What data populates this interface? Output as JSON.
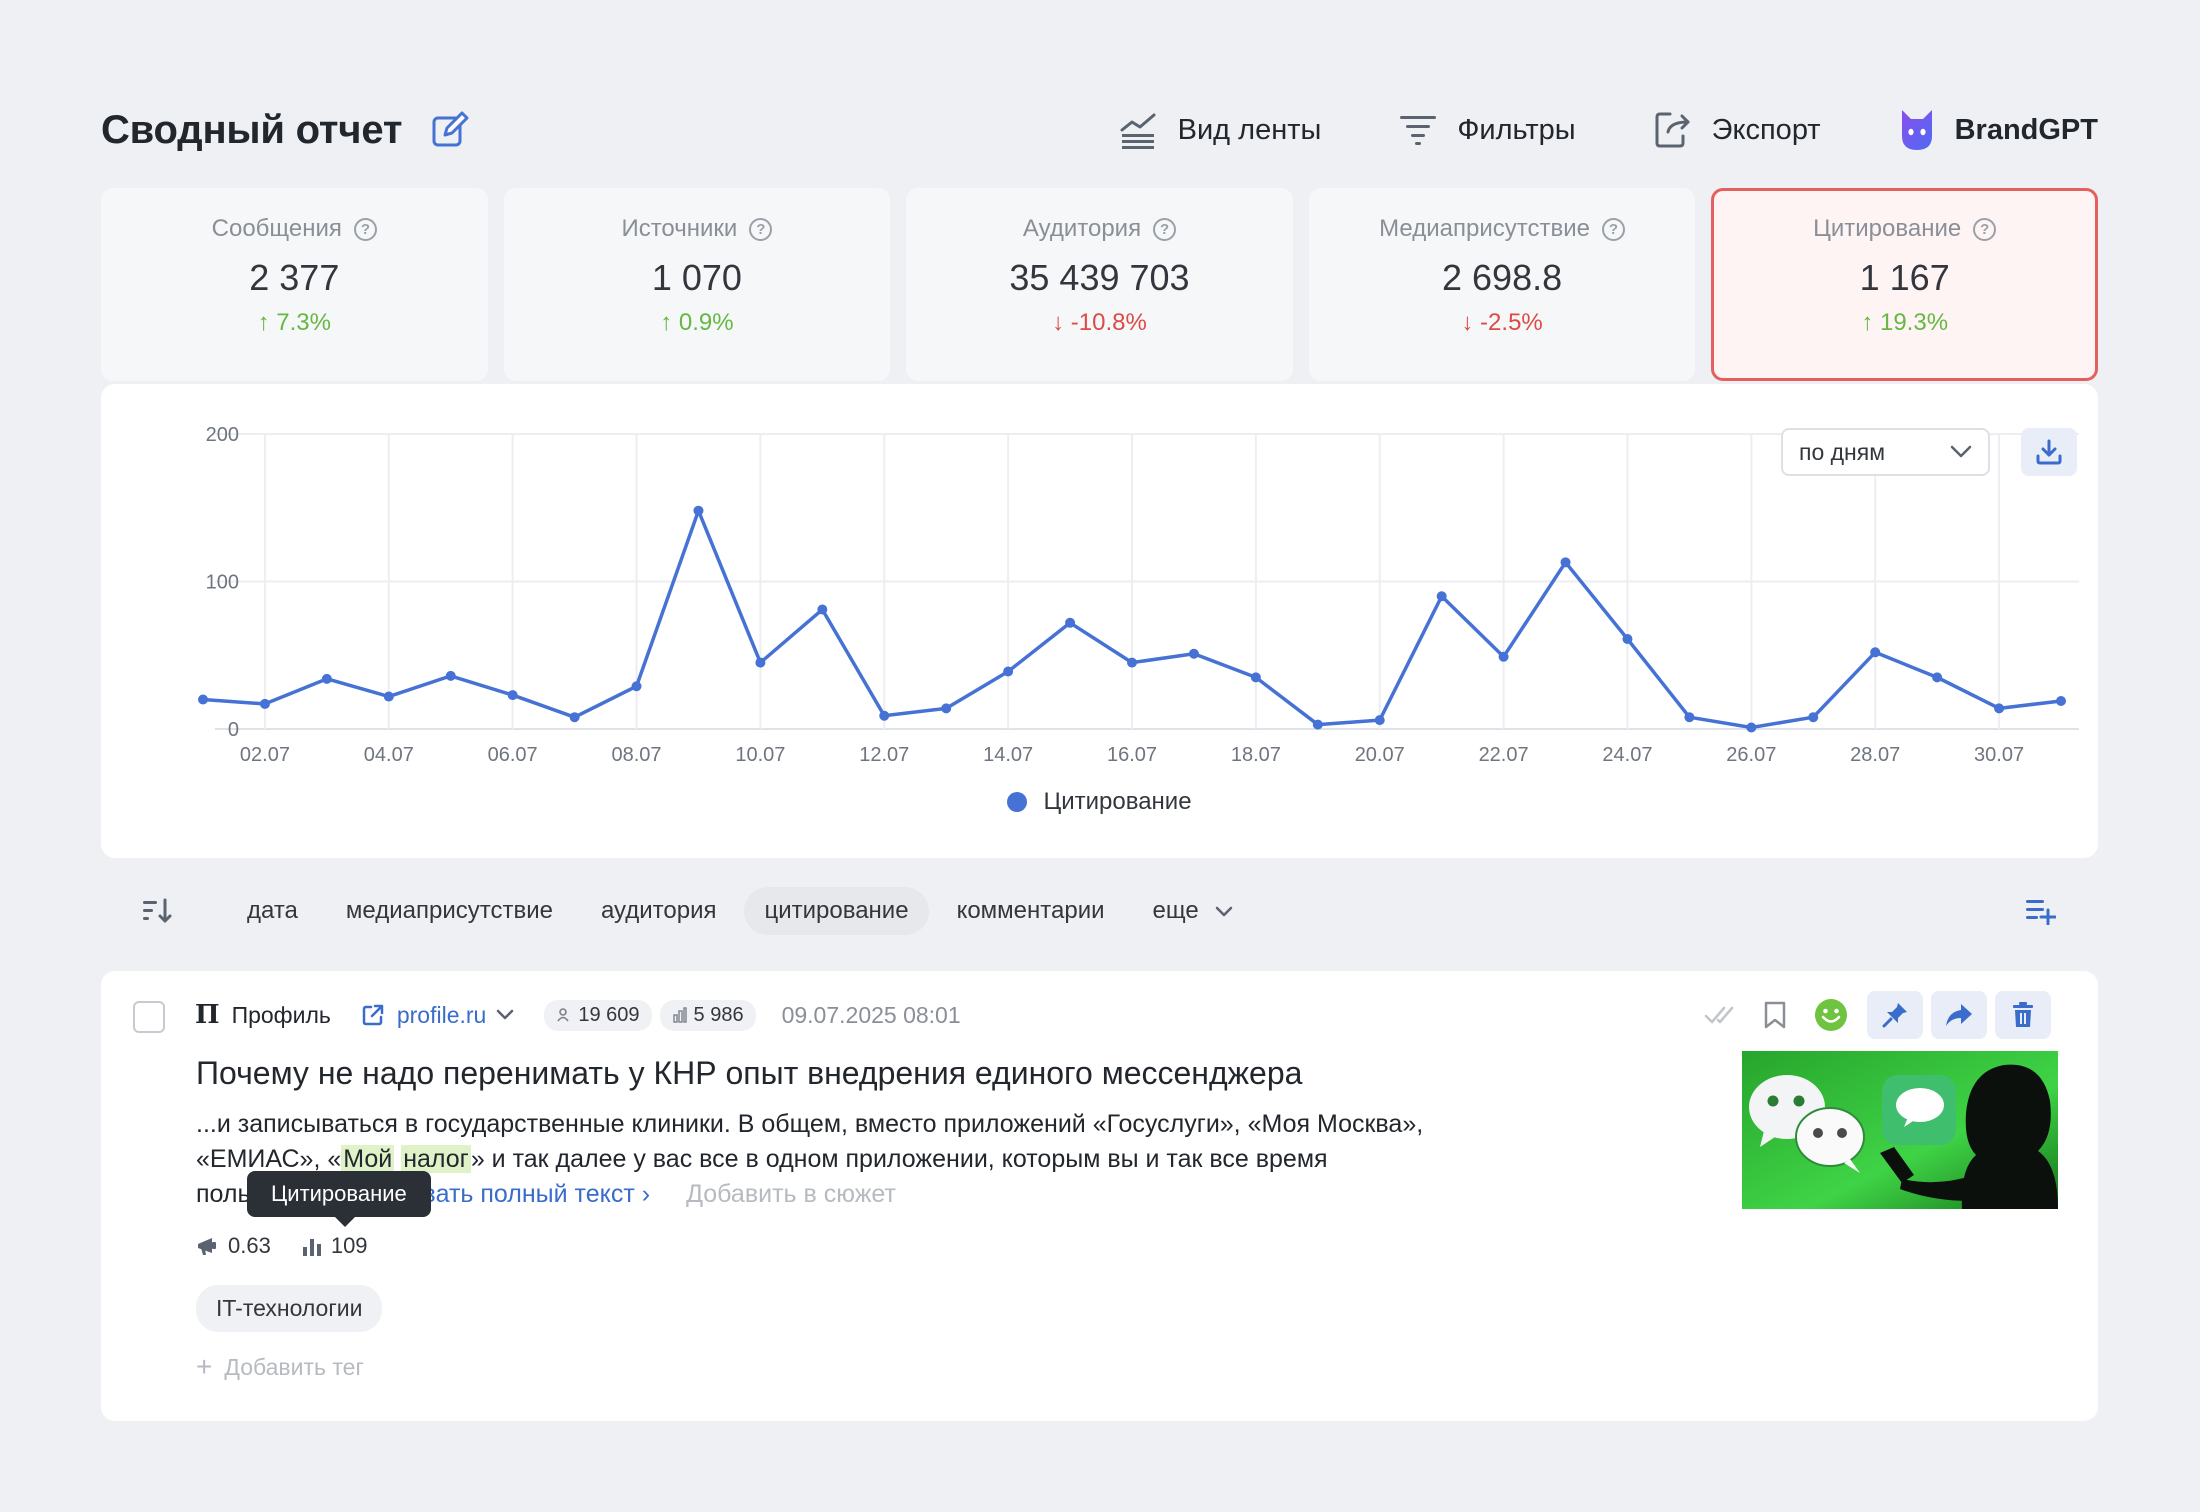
{
  "header": {
    "title": "Сводный отчет",
    "actions": [
      {
        "label": "Вид ленты",
        "icon": "feed-view-icon"
      },
      {
        "label": "Фильтры",
        "icon": "filter-icon"
      },
      {
        "label": "Экспорт",
        "icon": "export-icon"
      },
      {
        "label": "BrandGPT",
        "icon": "brandgpt-cat-icon"
      }
    ]
  },
  "stats": [
    {
      "label": "Сообщения",
      "value": "2 377",
      "change": "↑ 7.3%",
      "trend": "up"
    },
    {
      "label": "Источники",
      "value": "1 070",
      "change": "↑ 0.9%",
      "trend": "up"
    },
    {
      "label": "Аудитория",
      "value": "35 439 703",
      "change": "↓ -10.8%",
      "trend": "down"
    },
    {
      "label": "Медиаприсутствие",
      "value": "2 698.8",
      "change": "↓ -2.5%",
      "trend": "down"
    },
    {
      "label": "Цитирование",
      "value": "1 167",
      "change": "↑ 19.3%",
      "trend": "up",
      "active": true
    }
  ],
  "colors": {
    "accent": "#4572d4",
    "up": "#65b843",
    "down": "#dc4b45",
    "active_border": "#e3605e"
  },
  "chart_controls": {
    "period": "по дням"
  },
  "chart_data": {
    "type": "line",
    "ylim": [
      0,
      200
    ],
    "yticks": [
      "0",
      "100",
      "200"
    ],
    "xtick_labels": [
      "02.07",
      "04.07",
      "06.07",
      "08.07",
      "10.07",
      "12.07",
      "14.07",
      "16.07",
      "18.07",
      "20.07",
      "22.07",
      "24.07",
      "26.07",
      "28.07",
      "30.07"
    ],
    "x": [
      "01.07",
      "02.07",
      "03.07",
      "04.07",
      "05.07",
      "06.07",
      "07.07",
      "08.07",
      "09.07",
      "10.07",
      "11.07",
      "12.07",
      "13.07",
      "14.07",
      "15.07",
      "16.07",
      "17.07",
      "18.07",
      "19.07",
      "20.07",
      "21.07",
      "22.07",
      "23.07",
      "24.07",
      "25.07",
      "26.07",
      "27.07",
      "28.07",
      "29.07",
      "30.07",
      "31.07"
    ],
    "series": [
      {
        "name": "Цитирование",
        "values": [
          20,
          17,
          34,
          22,
          36,
          23,
          8,
          29,
          148,
          45,
          81,
          9,
          14,
          39,
          72,
          45,
          51,
          35,
          3,
          6,
          90,
          49,
          113,
          61,
          8,
          1,
          8,
          52,
          35,
          14,
          19
        ]
      }
    ],
    "legend": "bottom-center",
    "grid": true
  },
  "sort": {
    "tabs": [
      {
        "label": "дата",
        "active": false
      },
      {
        "label": "медиаприсутствие",
        "active": false
      },
      {
        "label": "аудитория",
        "active": false
      },
      {
        "label": "цитирование",
        "active": true
      },
      {
        "label": "комментарии",
        "active": false
      },
      {
        "label": "еще",
        "active": false,
        "dropdown": true
      }
    ]
  },
  "post": {
    "source_logo": "П",
    "source_name": "Профиль",
    "domain": "profile.ru",
    "audience": "19 609",
    "views": "5 986",
    "date": "09.07.2025 08:01",
    "title": "Почему не надо перенимать у КНР опыт внедрения единого мессенджера",
    "text_line1": "...и записываться в государственные клиники. В общем, вместо приложений «Госуслуги», «Моя Москва»,",
    "text_line2_a": "«ЕМИАС», «",
    "text_line2_hl1": "Мой",
    "text_line2_sp": " ",
    "text_line2_hl2": "налог",
    "text_line2_b": "» и так далее у вас все в одном приложении, которым вы и так все время",
    "text_line3_a": "поль",
    "show_more": "азать полный текст ›",
    "add_story": "Добавить в сюжет",
    "tooltip": "Цитирование",
    "metric_media": "0.63",
    "metric_citation": "109",
    "tag": "IT-технологии",
    "add_tag": "Добавить тег"
  }
}
